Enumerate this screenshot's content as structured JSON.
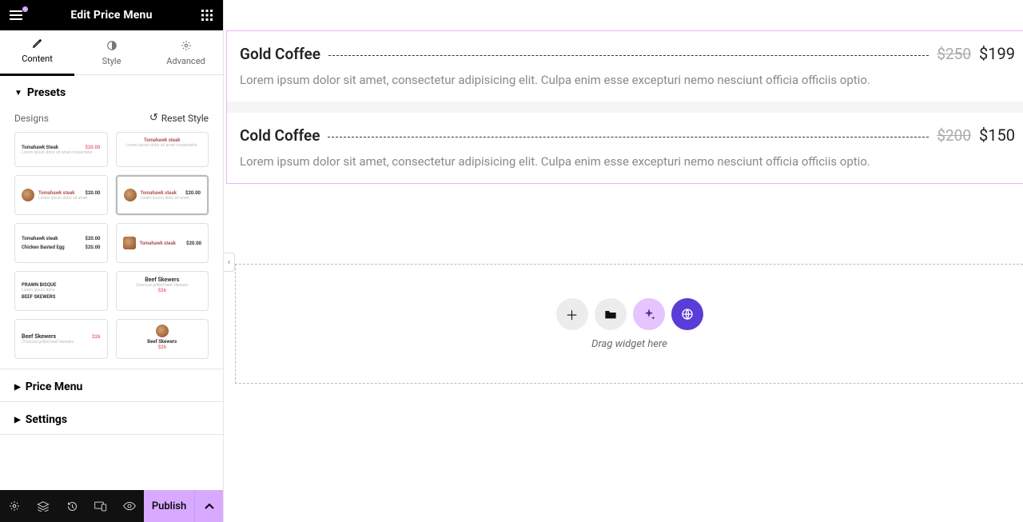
{
  "header": {
    "title": "Edit Price Menu"
  },
  "tabs": {
    "content": "Content",
    "style": "Style",
    "advanced": "Advanced"
  },
  "sections": {
    "presets": "Presets",
    "price_menu": "Price Menu",
    "settings": "Settings"
  },
  "designs_label": "Designs",
  "reset_style_label": "Reset Style",
  "presets": [
    {
      "title": "Tomahawk Steak",
      "price": "$20.00",
      "sub": "Lorem ipsum dolor sit amet consectetur."
    },
    {
      "title": "Tomahawk steak",
      "price": "",
      "sub": "Lorem ipsum dolor sit amet consectetur."
    },
    {
      "title": "Tomahawk steak",
      "price": "$20.00",
      "sub": "Lorem ipsum dolor sit amet."
    },
    {
      "title": "Tomahawk steak",
      "price": "$20.00",
      "sub": "Lorem ipsum dolor sit amet."
    },
    {
      "title": "Tomahawk steak",
      "price": "$20.00",
      "title2": "Chicken Basted Egg",
      "price2": "$20.00"
    },
    {
      "title": "Tomahawk steak",
      "price": "$20.00"
    },
    {
      "title": "PRAWN BISQUE",
      "price": "",
      "title2": "BEEF SKEWERS"
    },
    {
      "title": "Beef Skewers",
      "sub": "Charcoal grilled beef skewers",
      "price": "$26"
    },
    {
      "title": "Beef Skewers",
      "sub": "Charcoal grilled beef skewers",
      "price": "$26"
    },
    {
      "title": "Beef Skewers",
      "sub": "",
      "price": "$26"
    }
  ],
  "publish_label": "Publish",
  "menu_items": [
    {
      "title": "Gold Coffee",
      "old_price": "$250",
      "new_price": "$199",
      "desc": "Lorem ipsum dolor sit amet, consectetur adipisicing elit. Culpa enim esse excepturi nemo nesciunt officia officiis optio."
    },
    {
      "title": "Cold Coffee",
      "old_price": "$200",
      "new_price": "$150",
      "desc": "Lorem ipsum dolor sit amet, consectetur adipisicing elit. Culpa enim esse excepturi nemo nesciunt officia officiis optio."
    }
  ],
  "drop_label": "Drag widget here"
}
